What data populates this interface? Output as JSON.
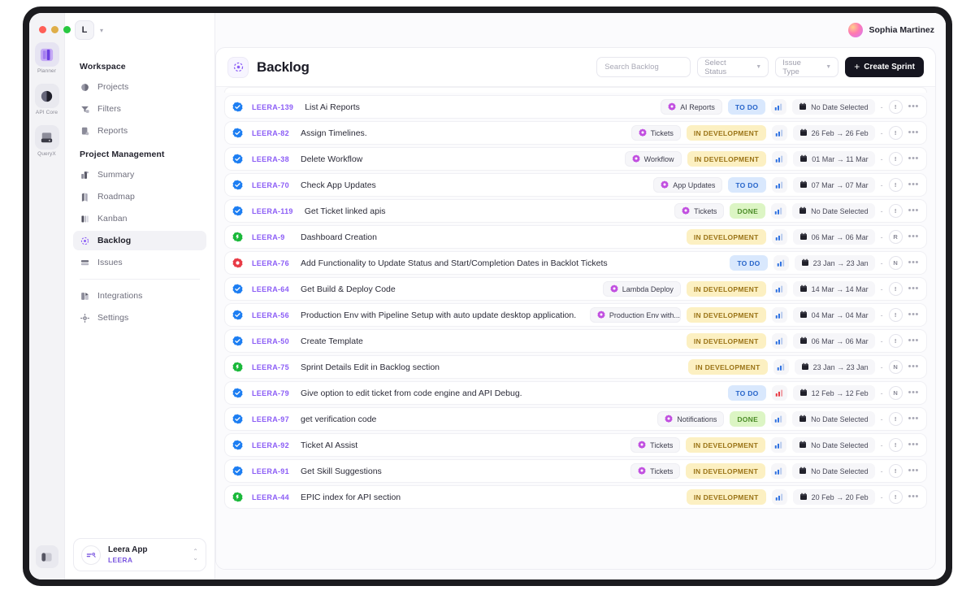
{
  "window": {
    "traffic_lights": [
      "close",
      "minimize",
      "maximize"
    ]
  },
  "app_rail": {
    "items": [
      {
        "label": "Planner",
        "icon": "planner-icon",
        "active": true
      },
      {
        "label": "API Core",
        "icon": "api-core-icon",
        "active": false
      },
      {
        "label": "QueryX",
        "icon": "queryx-icon",
        "active": false
      }
    ],
    "toggle_icon": "sidebar-toggle-icon"
  },
  "sidebar": {
    "workspace_badge": "L",
    "groups": [
      {
        "title": "Workspace",
        "items": [
          {
            "label": "Projects",
            "icon": "projects-icon",
            "active": false
          },
          {
            "label": "Filters",
            "icon": "filters-icon",
            "active": false
          },
          {
            "label": "Reports",
            "icon": "reports-icon",
            "active": false
          }
        ]
      },
      {
        "title": "Project Management",
        "items": [
          {
            "label": "Summary",
            "icon": "summary-icon",
            "active": false
          },
          {
            "label": "Roadmap",
            "icon": "roadmap-icon",
            "active": false
          },
          {
            "label": "Kanban",
            "icon": "kanban-icon",
            "active": false
          },
          {
            "label": "Backlog",
            "icon": "backlog-icon",
            "active": true
          },
          {
            "label": "Issues",
            "icon": "issues-icon",
            "active": false
          }
        ]
      }
    ],
    "footer_items": [
      {
        "label": "Integrations",
        "icon": "integrations-icon",
        "active": false
      },
      {
        "label": "Settings",
        "icon": "settings-icon",
        "active": false
      }
    ],
    "app_card": {
      "name": "Leera App",
      "key": "LEERA",
      "icon": "leera-app-icon"
    }
  },
  "topbar": {
    "user_name": "Sophia Martinez"
  },
  "header": {
    "title": "Backlog",
    "icon": "backlog-icon",
    "search_placeholder": "Search Backlog",
    "search_value": "",
    "status_filter": "Select Status",
    "issue_type_filter": "Issue Type",
    "create_button": "Create Sprint"
  },
  "colors": {
    "accent": "#8b5cf6",
    "todo_bg": "#d9e8fd",
    "todo_fg": "#2563c9",
    "dev_bg": "#fcf0c2",
    "dev_fg": "#9a7316",
    "done_bg": "#dcf5c4",
    "done_fg": "#4b8c28",
    "primary_button": "#15151f"
  },
  "rows": [
    {
      "type": "task",
      "key": "LEERA-139",
      "title": "List Ai Reports",
      "label": "AI Reports",
      "status": "TO DO",
      "status_class": "st-todo",
      "priority": "medium",
      "date": "No Date Selected",
      "assignee": "!"
    },
    {
      "type": "task",
      "key": "LEERA-82",
      "title": "Assign Timelines.",
      "label": "Tickets",
      "status": "IN DEVELOPMENT",
      "status_class": "st-dev",
      "priority": "medium",
      "date": "26 Feb → 26 Feb",
      "assignee": "!"
    },
    {
      "type": "task",
      "key": "LEERA-38",
      "title": "Delete Workflow",
      "label": "Workflow",
      "status": "IN DEVELOPMENT",
      "status_class": "st-dev",
      "priority": "medium",
      "date": "01 Mar → 11 Mar",
      "assignee": "!"
    },
    {
      "type": "task",
      "key": "LEERA-70",
      "title": "Check App Updates",
      "label": "App Updates",
      "status": "TO DO",
      "status_class": "st-todo",
      "priority": "medium",
      "date": "07 Mar → 07 Mar",
      "assignee": "!"
    },
    {
      "type": "task",
      "key": "LEERA-119",
      "title": "Get Ticket linked apis",
      "label": "Tickets",
      "status": "DONE",
      "status_class": "st-done",
      "priority": "medium",
      "date": "No Date Selected",
      "assignee": "!"
    },
    {
      "type": "epic",
      "key": "LEERA-9",
      "title": "Dashboard Creation",
      "label": "",
      "status": "IN DEVELOPMENT",
      "status_class": "st-dev",
      "priority": "medium",
      "date": "06 Mar → 06 Mar",
      "assignee": "R"
    },
    {
      "type": "bug",
      "key": "LEERA-76",
      "title": "Add Functionality to Update Status and Start/Completion Dates in Backlot Tickets",
      "label": "",
      "status": "TO DO",
      "status_class": "st-todo",
      "priority": "medium",
      "date": "23 Jan → 23 Jan",
      "assignee": "N"
    },
    {
      "type": "task",
      "key": "LEERA-64",
      "title": "Get Build & Deploy Code",
      "label": "Lambda Deploy",
      "status": "IN DEVELOPMENT",
      "status_class": "st-dev",
      "priority": "medium",
      "date": "14 Mar → 14 Mar",
      "assignee": "!"
    },
    {
      "type": "task",
      "key": "LEERA-56",
      "title": "Production Env with Pipeline Setup with auto update desktop application.",
      "label": "Production Env with...",
      "status": "IN DEVELOPMENT",
      "status_class": "st-dev",
      "priority": "medium",
      "date": "04 Mar → 04 Mar",
      "assignee": "!"
    },
    {
      "type": "task",
      "key": "LEERA-50",
      "title": "Create Template",
      "label": "",
      "status": "IN DEVELOPMENT",
      "status_class": "st-dev",
      "priority": "medium",
      "date": "06 Mar → 06 Mar",
      "assignee": "!"
    },
    {
      "type": "epic",
      "key": "LEERA-75",
      "title": "Sprint Details Edit in Backlog section",
      "label": "",
      "status": "IN DEVELOPMENT",
      "status_class": "st-dev",
      "priority": "medium",
      "date": "23 Jan → 23 Jan",
      "assignee": "N"
    },
    {
      "type": "task",
      "key": "LEERA-79",
      "title": "Give option to edit ticket from code engine and API Debug.",
      "label": "",
      "status": "TO DO",
      "status_class": "st-todo",
      "priority": "high",
      "date": "12 Feb → 12 Feb",
      "assignee": "N"
    },
    {
      "type": "task",
      "key": "LEERA-97",
      "title": "get verification code",
      "label": "Notifications",
      "status": "DONE",
      "status_class": "st-done",
      "priority": "medium",
      "date": "No Date Selected",
      "assignee": "!"
    },
    {
      "type": "task",
      "key": "LEERA-92",
      "title": "Ticket AI Assist",
      "label": "Tickets",
      "status": "IN DEVELOPMENT",
      "status_class": "st-dev",
      "priority": "medium",
      "date": "No Date Selected",
      "assignee": "!"
    },
    {
      "type": "task",
      "key": "LEERA-91",
      "title": "Get Skill Suggestions",
      "label": "Tickets",
      "status": "IN DEVELOPMENT",
      "status_class": "st-dev",
      "priority": "medium",
      "date": "No Date Selected",
      "assignee": "!"
    },
    {
      "type": "epic",
      "key": "LEERA-44",
      "title": "EPIC index for API section",
      "label": "",
      "status": "IN DEVELOPMENT",
      "status_class": "st-dev",
      "priority": "medium",
      "date": "20 Feb → 20 Feb",
      "assignee": "!"
    }
  ]
}
